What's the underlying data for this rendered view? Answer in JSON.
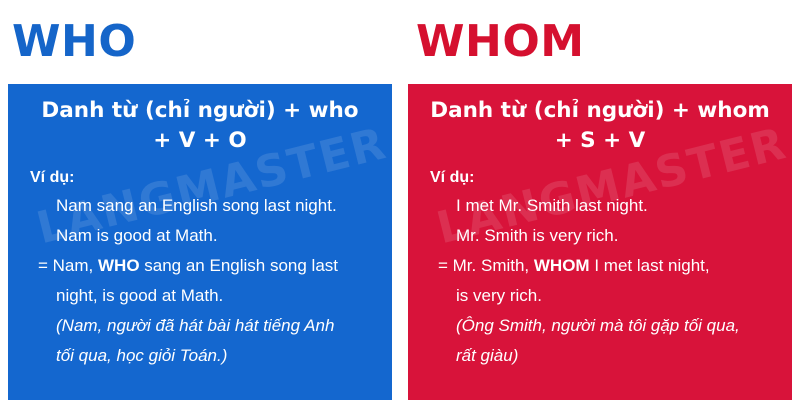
{
  "who": {
    "heading": "WHO",
    "title_line1": "Danh từ (chỉ người) + who",
    "title_line2": "+ V + O",
    "example_label": "Ví dụ:",
    "line1": "Nam sang an English song last night.",
    "line2": "Nam is good at Math.",
    "line3_prefix": "= Nam, ",
    "line3_keyword": "WHO",
    "line3_suffix": " sang an English song last",
    "line4": "night, is good at Math.",
    "line5": "(Nam, người đã hát bài hát tiếng Anh",
    "line6": "tối qua, học giỏi Toán.)",
    "watermark": "LANGMASTER",
    "color": "#1467cf"
  },
  "whom": {
    "heading": "WHOM",
    "title_line1": "Danh từ (chỉ người) + whom",
    "title_line2": "+ S + V",
    "example_label": "Ví dụ:",
    "line1": "I met Mr. Smith last night.",
    "line2": "Mr. Smith is very rich.",
    "line3_prefix": "= Mr. Smith, ",
    "line3_keyword": "WHOM",
    "line3_suffix": " I met last night,",
    "line4": "is very rich.",
    "line5": "(Ông Smith, người mà tôi gặp tối qua,",
    "line6": "rất giàu)",
    "watermark": "LANGMASTER",
    "color": "#d8133a"
  }
}
